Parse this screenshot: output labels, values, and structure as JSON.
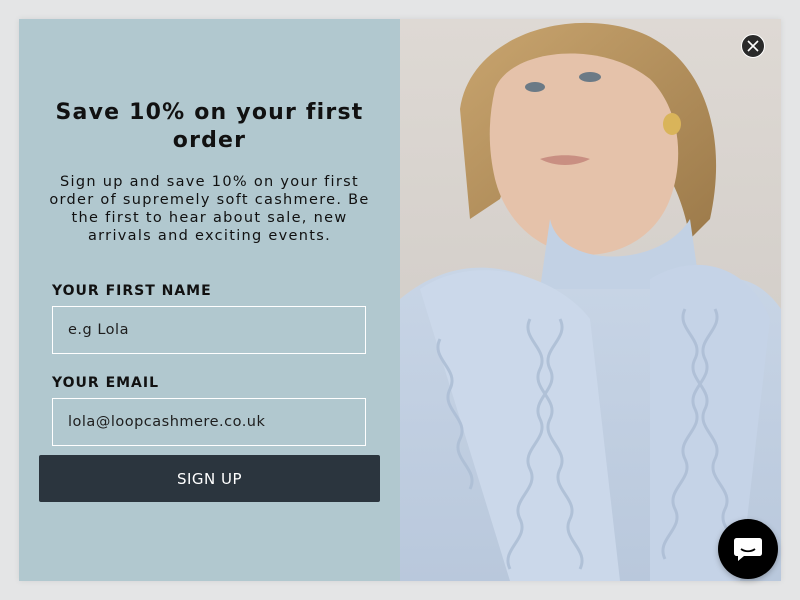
{
  "popup": {
    "title": "Save 10% on your first order",
    "subtitle": "Sign up and save 10% on your first order of supremely soft cashmere.  Be the first to hear about sale, new arrivals and exciting events.",
    "first_name": {
      "label": "YOUR FIRST NAME",
      "placeholder": "e.g Lola",
      "value": ""
    },
    "email": {
      "label": "YOUR EMAIL",
      "placeholder": "lola@loopcashmere.co.uk",
      "value": ""
    },
    "submit_label": "SIGN UP",
    "close_icon": "close-icon",
    "image_description": "Model wearing pale blue cable-knit cashmere scarf and turtleneck"
  },
  "chat": {
    "icon": "chat-icon"
  },
  "colors": {
    "panel_background": "#b1c8cf",
    "button_background": "#2b353e",
    "button_text": "#ffffff",
    "page_background": "#e4e5e6"
  }
}
